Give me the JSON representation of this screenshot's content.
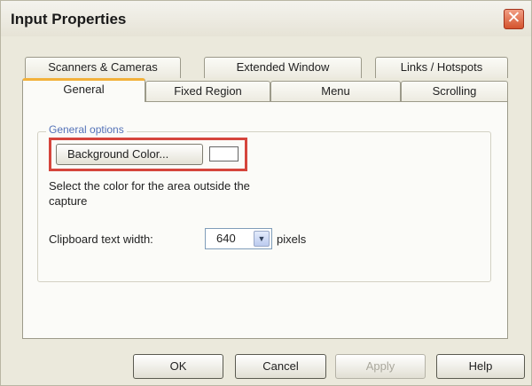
{
  "window": {
    "title": "Input Properties",
    "close_glyph": "✕"
  },
  "tabs_back": [
    {
      "label": "Scanners & Cameras"
    },
    {
      "label": "Extended Window"
    },
    {
      "label": "Links / Hotspots"
    }
  ],
  "tabs_front": [
    {
      "label": "General",
      "active": true
    },
    {
      "label": "Fixed Region"
    },
    {
      "label": "Menu"
    },
    {
      "label": "Scrolling"
    }
  ],
  "general_options": {
    "legend": "General options",
    "background_button_label": "Background Color...",
    "swatch_color": "#ffffff",
    "description": "Select the color for the area outside the capture",
    "clipboard_label": "Clipboard text width:",
    "clipboard_value": "640",
    "clipboard_units": "pixels"
  },
  "buttons": {
    "ok": "OK",
    "cancel": "Cancel",
    "apply": "Apply",
    "help": "Help"
  },
  "icons": {
    "close": "close-icon",
    "dropdown": "chevron-down-icon"
  },
  "colors": {
    "highlight": "#d5453c",
    "active_tab_accent": "#f2b13a",
    "legend_text": "#5472b8"
  }
}
